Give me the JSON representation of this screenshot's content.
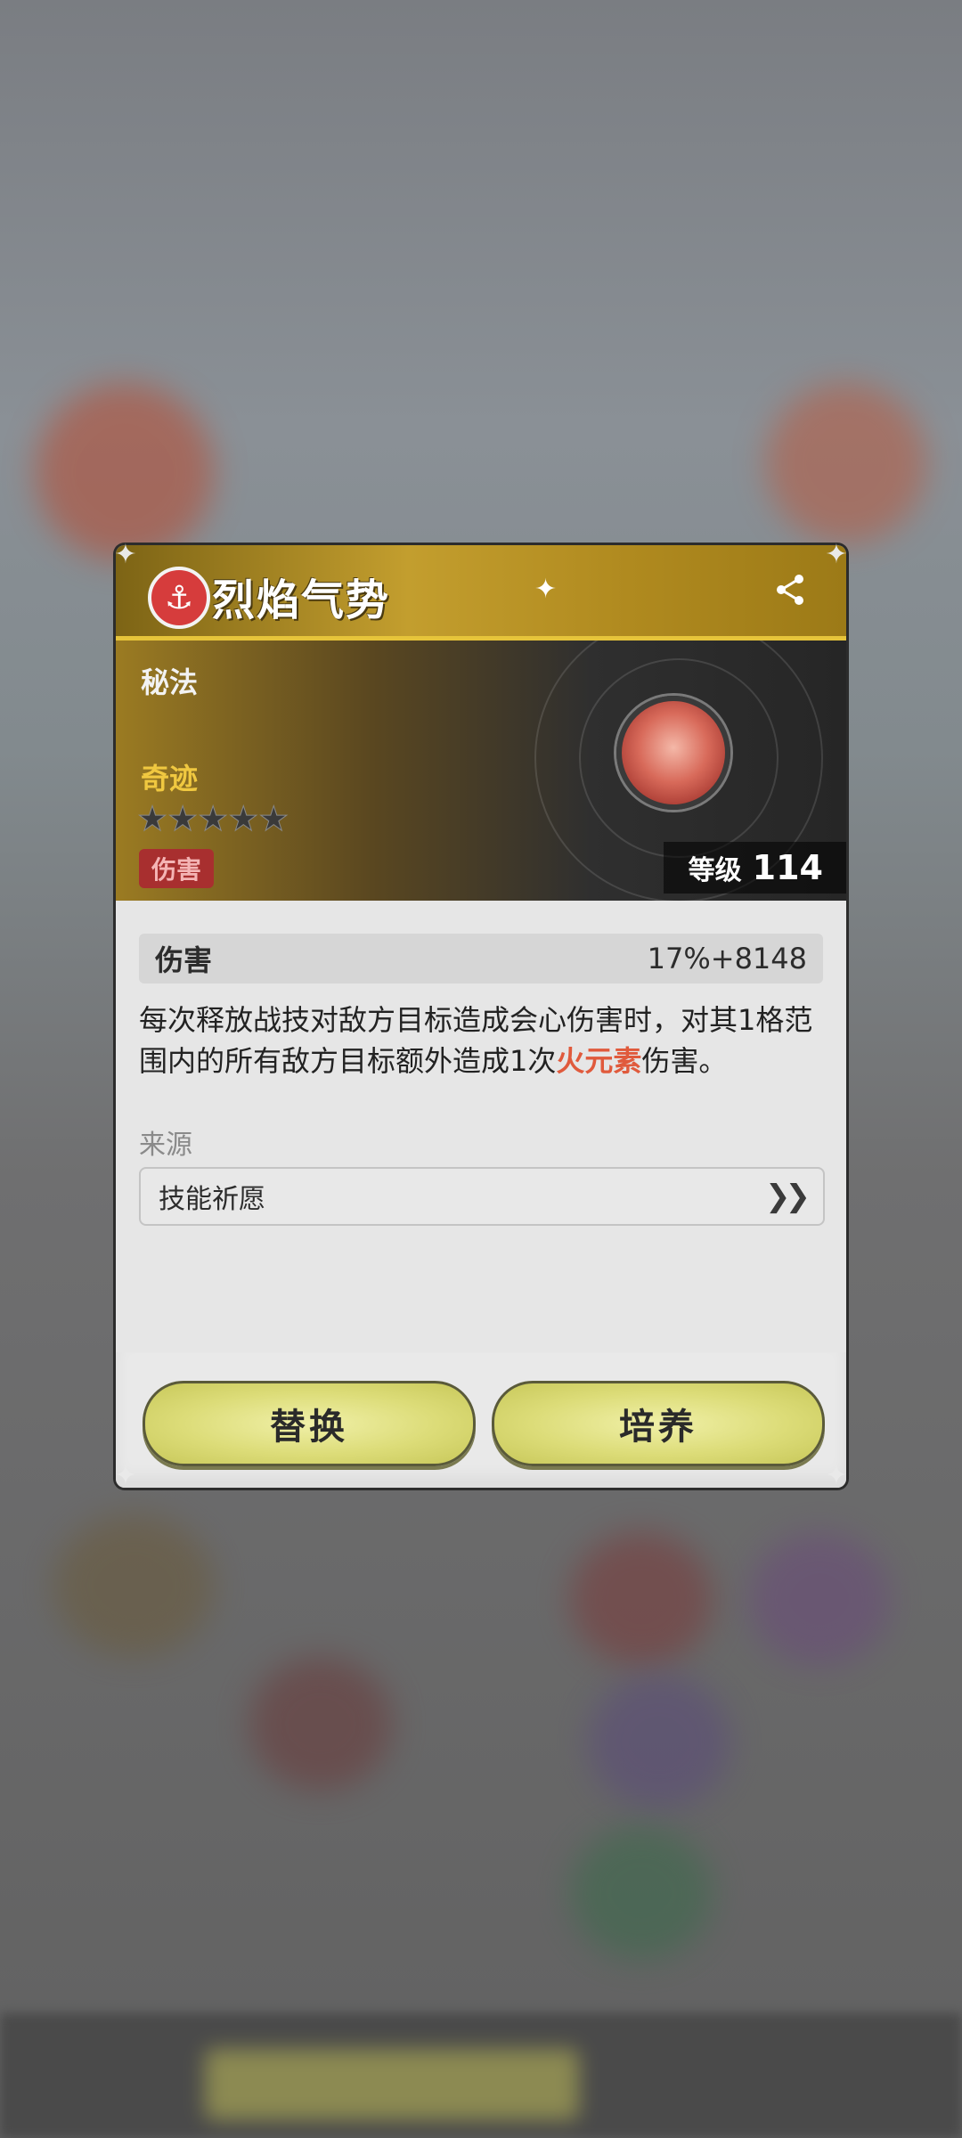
{
  "skill": {
    "name": "烈焰气势",
    "type": "秘法",
    "rarity": "奇迹",
    "stars": "★★★★★",
    "tag": "伤害",
    "level_label": "等级",
    "level_value": "114"
  },
  "stat": {
    "label": "伤害",
    "value": "17%+8148"
  },
  "description": {
    "part1": "每次释放战技对敌方目标造成会心伤害时，对其1格范围内的所有敌方目标额外造成1次",
    "highlight": "火元素",
    "part2": "伤害。"
  },
  "source": {
    "label": "来源",
    "item": "技能祈愿"
  },
  "buttons": {
    "replace": "替换",
    "cultivate": "培养"
  },
  "icons": {
    "badge": "anchor-emblem-icon",
    "share": "share-icon",
    "orb": "fire-orb-icon",
    "go": "double-chevron-right-icon"
  },
  "colors": {
    "header_gold": "#c39e2e",
    "rarity": "#f0c840",
    "tag_bg": "#a82f2f",
    "highlight": "#e05a3c",
    "button": "#dcdc78"
  }
}
